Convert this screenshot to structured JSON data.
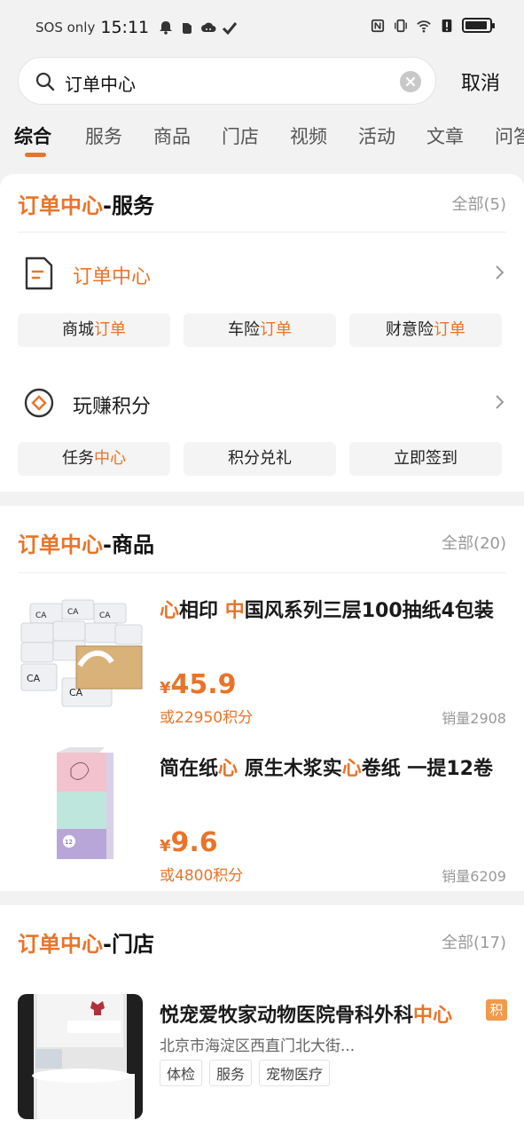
{
  "status_bar": {
    "sos": "SOS only",
    "time": "15:11"
  },
  "search": {
    "query": "订单中心",
    "cancel": "取消"
  },
  "tabs": [
    {
      "label": "综合"
    },
    {
      "label": "服务"
    },
    {
      "label": "商品"
    },
    {
      "label": "门店"
    },
    {
      "label": "视频"
    },
    {
      "label": "活动"
    },
    {
      "label": "文章"
    },
    {
      "label": "问答"
    }
  ],
  "services_section": {
    "title_hl": "订单中心",
    "title_rest": "-服务",
    "all": "全部(5)",
    "items": [
      {
        "name": "订单中心",
        "chips": [
          {
            "pre": "商城",
            "hl": "订单",
            "post": ""
          },
          {
            "pre": "车险",
            "hl": "订单",
            "post": ""
          },
          {
            "pre": "财意险",
            "hl": "订单",
            "post": ""
          }
        ]
      },
      {
        "name": "玩赚积分",
        "chips": [
          {
            "pre": "任务",
            "hl": "中心",
            "post": ""
          },
          {
            "pre": "积分兑礼",
            "hl": "",
            "post": ""
          },
          {
            "pre": "立即签到",
            "hl": "",
            "post": ""
          }
        ]
      }
    ]
  },
  "products_section": {
    "title_hl": "订单中心",
    "title_rest": "-商品",
    "all": "全部(20)",
    "products": [
      {
        "title_parts": [
          {
            "t": "心",
            "hl": true
          },
          {
            "t": "相印 ",
            "hl": false
          },
          {
            "t": "中",
            "hl": true
          },
          {
            "t": "国风系列三层100抽纸4包装",
            "hl": false
          }
        ],
        "currency": "¥",
        "price": "45.9",
        "points": "或22950积分",
        "sales": "销量2908"
      },
      {
        "title_parts": [
          {
            "t": "简在纸",
            "hl": false
          },
          {
            "t": "心",
            "hl": true
          },
          {
            "t": " 原生木浆实",
            "hl": false
          },
          {
            "t": "心",
            "hl": true
          },
          {
            "t": "卷纸 一提12卷",
            "hl": false
          }
        ],
        "currency": "¥",
        "price": "9.6",
        "points": "或4800积分",
        "sales": "销量6209"
      }
    ]
  },
  "stores_section": {
    "title_hl": "订单中心",
    "title_rest": "-门店",
    "all": "全部(17)",
    "stores": [
      {
        "name_pre": "悦宠爱牧家动物医院骨科外科",
        "name_hl": "中心",
        "badge": "积",
        "address": "北京市海淀区西直门北大街...",
        "tags": [
          "体检",
          "服务",
          "宠物医疗"
        ]
      }
    ]
  },
  "colors": {
    "accent": "#e8742a",
    "background": "#f2f2f2"
  }
}
